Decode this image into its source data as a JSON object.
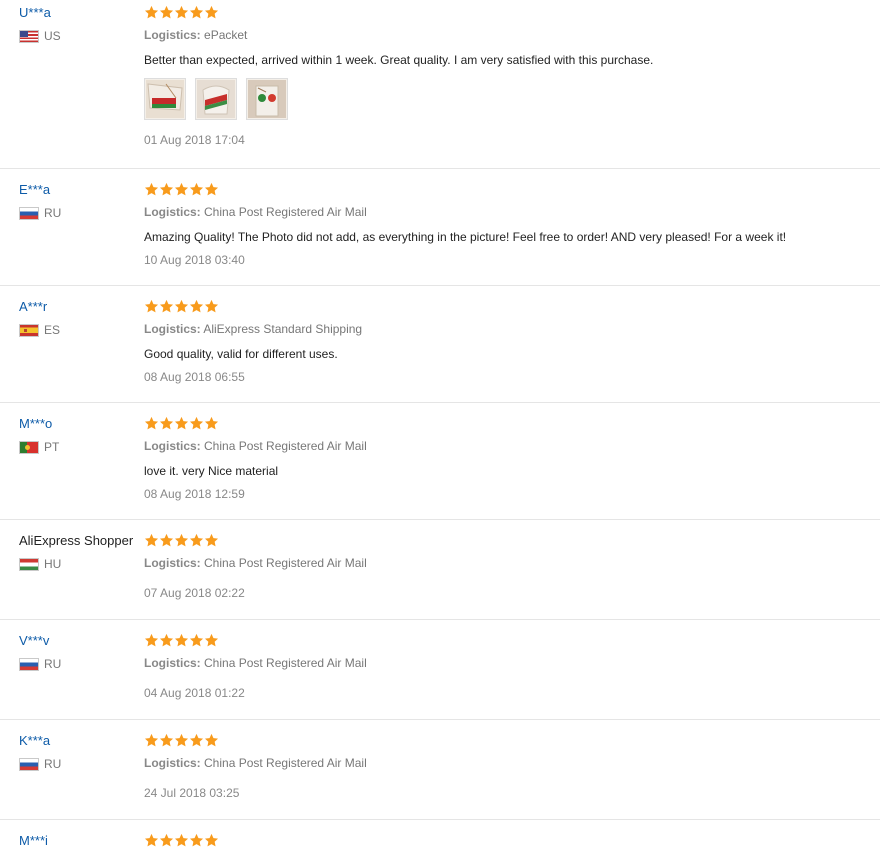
{
  "labels": {
    "logistics_prefix": "Logistics:"
  },
  "colors": {
    "star": "#f89b1c",
    "username": "#0d5ba8",
    "date": "#888888"
  },
  "reviews": [
    {
      "user": "U***a",
      "country_code": "US",
      "flag": "us",
      "rating": 5,
      "logistics": "ePacket",
      "text": "Better than expected, arrived within 1 week. Great quality. I am very satisfied with this purchase.",
      "photos": [
        "review-photo-1",
        "review-photo-2",
        "review-photo-3"
      ],
      "date": "01 Aug 2018 17:04"
    },
    {
      "user": "E***a",
      "country_code": "RU",
      "flag": "ru",
      "rating": 5,
      "logistics": "China Post Registered Air Mail",
      "text": "Amazing Quality! The Photo did not add, as everything in the picture! Feel free to order! AND very pleased! For a week it!",
      "date": "10 Aug 2018 03:40"
    },
    {
      "user": "A***r",
      "country_code": "ES",
      "flag": "es",
      "rating": 5,
      "logistics": "AliExpress Standard Shipping",
      "text": "Good quality, valid for different uses.",
      "date": "08 Aug 2018 06:55"
    },
    {
      "user": "M***o",
      "country_code": "PT",
      "flag": "pt",
      "rating": 5,
      "logistics": "China Post Registered Air Mail",
      "text": "love it. very Nice material",
      "date": "08 Aug 2018 12:59"
    },
    {
      "user": "AliExpress Shopper",
      "country_code": "HU",
      "flag": "hu",
      "rating": 5,
      "logistics": "China Post Registered Air Mail",
      "text": "",
      "date": "07 Aug 2018 02:22"
    },
    {
      "user": "V***v",
      "country_code": "RU",
      "flag": "ru",
      "rating": 5,
      "logistics": "China Post Registered Air Mail",
      "text": "",
      "date": "04 Aug 2018 01:22"
    },
    {
      "user": "K***a",
      "country_code": "RU",
      "flag": "ru",
      "rating": 5,
      "logistics": "China Post Registered Air Mail",
      "text": "",
      "date": "24 Jul 2018 03:25"
    },
    {
      "user": "M***i",
      "country_code": "",
      "flag": "",
      "rating": 5,
      "logistics": "",
      "text": "",
      "date": ""
    }
  ]
}
